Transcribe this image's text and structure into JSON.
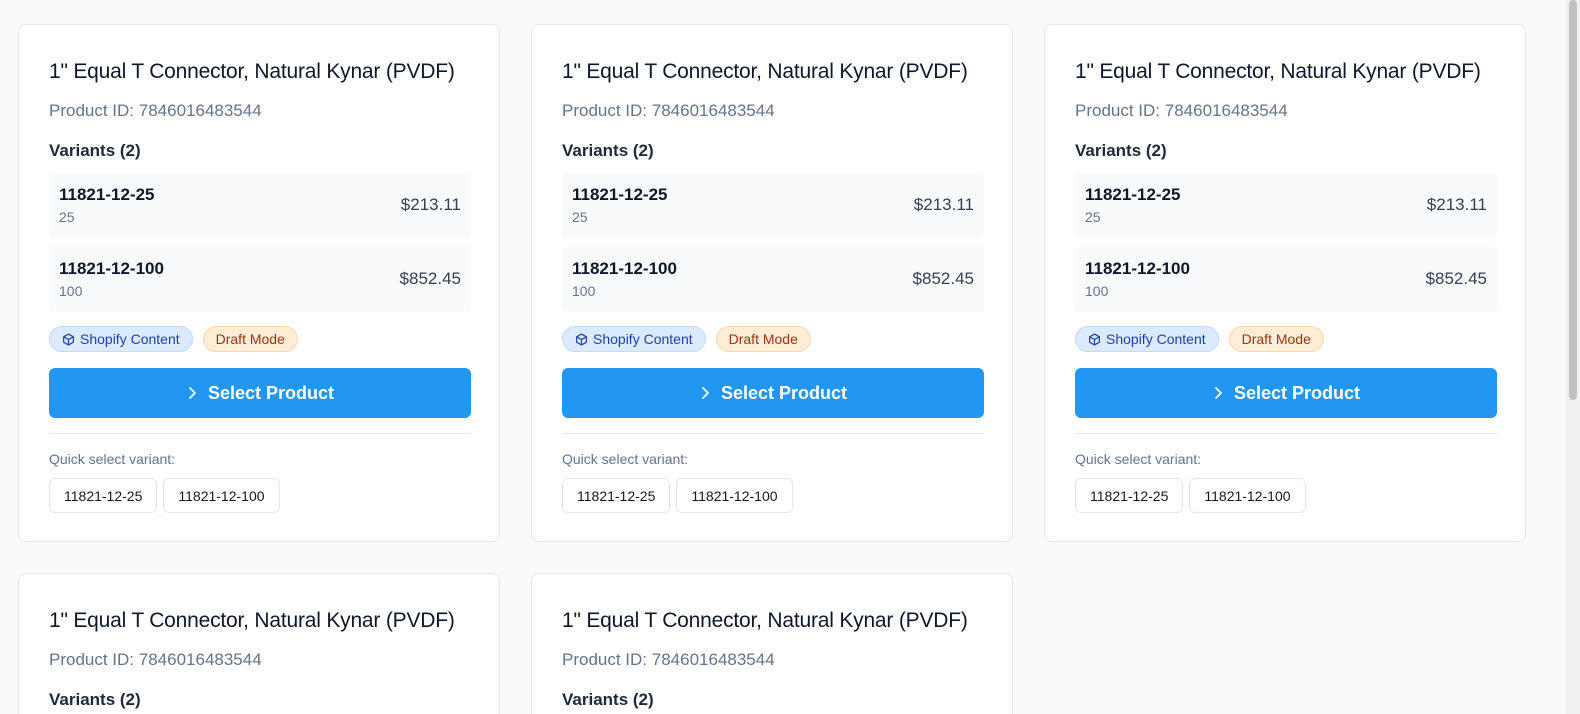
{
  "products": [
    {
      "title": "1\" Equal T Connector, Natural Kynar (PVDF)",
      "product_id": "Product ID: 7846016483544",
      "variants_heading": "Variants (2)",
      "variants": [
        {
          "sku": "11821-12-25",
          "title": "25",
          "price": "$213.11"
        },
        {
          "sku": "11821-12-100",
          "title": "100",
          "price": "$852.45"
        }
      ],
      "badges": {
        "shopify": "Shopify Content",
        "draft": "Draft Mode"
      },
      "select_label": "Select Product",
      "quick_select_label": "Quick select variant:",
      "quick_select": [
        "11821-12-25",
        "11821-12-100"
      ]
    },
    {
      "title": "1\" Equal T Connector, Natural Kynar (PVDF)",
      "product_id": "Product ID: 7846016483544",
      "variants_heading": "Variants (2)",
      "variants": [
        {
          "sku": "11821-12-25",
          "title": "25",
          "price": "$213.11"
        },
        {
          "sku": "11821-12-100",
          "title": "100",
          "price": "$852.45"
        }
      ],
      "badges": {
        "shopify": "Shopify Content",
        "draft": "Draft Mode"
      },
      "select_label": "Select Product",
      "quick_select_label": "Quick select variant:",
      "quick_select": [
        "11821-12-25",
        "11821-12-100"
      ]
    },
    {
      "title": "1\" Equal T Connector, Natural Kynar (PVDF)",
      "product_id": "Product ID: 7846016483544",
      "variants_heading": "Variants (2)",
      "variants": [
        {
          "sku": "11821-12-25",
          "title": "25",
          "price": "$213.11"
        },
        {
          "sku": "11821-12-100",
          "title": "100",
          "price": "$852.45"
        }
      ],
      "badges": {
        "shopify": "Shopify Content",
        "draft": "Draft Mode"
      },
      "select_label": "Select Product",
      "quick_select_label": "Quick select variant:",
      "quick_select": [
        "11821-12-25",
        "11821-12-100"
      ]
    },
    {
      "title": "1\" Equal T Connector, Natural Kynar (PVDF)",
      "product_id": "Product ID: 7846016483544",
      "variants_heading": "Variants (2)"
    },
    {
      "title": "1\" Equal T Connector, Natural Kynar (PVDF)",
      "product_id": "Product ID: 7846016483544",
      "variants_heading": "Variants (2)"
    }
  ],
  "icons": {
    "select": "chevron-right-icon",
    "shopify": "package-icon"
  },
  "colors": {
    "primary": "#2196f3",
    "shopify_badge": "#dbeafe",
    "draft_badge": "#ffedd5"
  }
}
